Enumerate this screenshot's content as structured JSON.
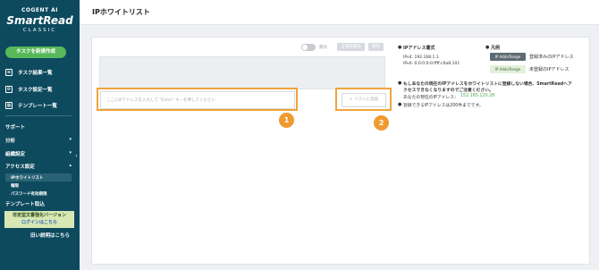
{
  "sidebar": {
    "brand_small": "COGENT AI",
    "brand_main": "SmartRead",
    "brand_sub": "CLASSIC",
    "new_task": "タスクを新規作成",
    "nav": [
      {
        "label": "タスク結果一覧",
        "icon": "document-icon"
      },
      {
        "label": "タスク設定一覧",
        "icon": "settings-search-icon"
      },
      {
        "label": "テンプレート一覧",
        "icon": "template-grid-icon"
      }
    ],
    "support": "サポート",
    "sections": [
      {
        "label": "分析",
        "icon": "chevron-down-icon"
      },
      {
        "label": "組織設定",
        "icon": "chevron-down-icon"
      },
      {
        "label": "アクセス設定",
        "icon": "chevron-up-icon"
      }
    ],
    "access_sub": [
      "IPホワイトリスト",
      "権限",
      "パスワード有効期限"
    ],
    "template_import": "テンプレート取込",
    "legacy_line1": "非定型文書強化バージョン",
    "legacy_link": "ログインはこちら",
    "old_desc": "旧い説明はこちら"
  },
  "header": {
    "title": "IPホワイトリスト"
  },
  "main": {
    "toggle_label": "無効",
    "top_buttons": [
      "全選択解除",
      "削除"
    ],
    "input_placeholder": "ここにIPアドレスを入力して \"Enter\" キーを押してください",
    "add_button": "+ リストに追加",
    "badges": [
      "1",
      "2"
    ]
  },
  "info": {
    "format_title": "IPアドレス書式",
    "ipv4": "IPv4: 192.168.1.1",
    "ipv6": "IPv6: 0:0:0:0:0:ffff:c0a8:101",
    "legend_title": "凡例",
    "chip_label": "IP Addr/Range",
    "registered": "登録済みのIPアドレス",
    "unregistered": "未登録のIPアドレス",
    "warning_line1": "もしあなたの現在のIPアドレスをホワイトリストに登録しない場合、SmartReadへア",
    "warning_line2": "クセスできなくなりますのでご注意ください。",
    "current_ip_label": "あなたの現在のIPアドレス：",
    "current_ip": "152.165.120.28",
    "limit": "登録できるIPアドレスは200件までです。"
  }
}
